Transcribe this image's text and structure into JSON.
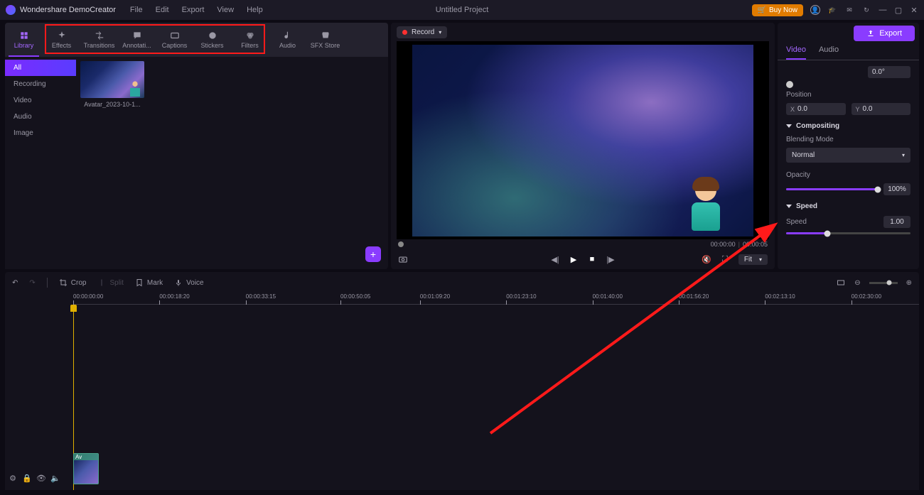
{
  "app_name": "Wondershare DemoCreator",
  "menu": [
    "File",
    "Edit",
    "Export",
    "View",
    "Help"
  ],
  "project_title": "Untitled Project",
  "buy_label": "Buy Now",
  "tabs": [
    {
      "label": "Library",
      "active": true
    },
    {
      "label": "Effects"
    },
    {
      "label": "Transitions"
    },
    {
      "label": "Annotati..."
    },
    {
      "label": "Captions"
    },
    {
      "label": "Stickers"
    },
    {
      "label": "Filters"
    },
    {
      "label": "Audio"
    },
    {
      "label": "SFX Store"
    }
  ],
  "sidebar": [
    {
      "label": "All",
      "active": true
    },
    {
      "label": "Recording"
    },
    {
      "label": "Video"
    },
    {
      "label": "Audio"
    },
    {
      "label": "Image"
    }
  ],
  "media_item": {
    "label": "Avatar_2023-10-1..."
  },
  "record_label": "Record",
  "export_label": "Export",
  "time_current": "00:00:00",
  "time_total": "00:00:05",
  "fit_label": "Fit",
  "properties": {
    "tabs": {
      "video": "Video",
      "audio": "Audio"
    },
    "top_value": "0.0°",
    "position_label": "Position",
    "pos_x": "0.0",
    "pos_y": "0.0",
    "compositing": "Compositing",
    "blending_label": "Blending Mode",
    "blending_value": "Normal",
    "opacity_label": "Opacity",
    "opacity_value": "100%",
    "speed_section": "Speed",
    "speed_label": "Speed",
    "speed_value": "1.00"
  },
  "tl_tools": {
    "crop": "Crop",
    "split": "Split",
    "mark": "Mark",
    "voice": "Voice"
  },
  "ruler": [
    "00:00:00:00",
    "00:00:18:20",
    "00:00:33:15",
    "00:00:50:05",
    "00:01:09:20",
    "00:01:23:10",
    "00:01:40:00",
    "00:01:56:20",
    "00:02:13:10",
    "00:02:30:00"
  ],
  "clip_label": "Av"
}
